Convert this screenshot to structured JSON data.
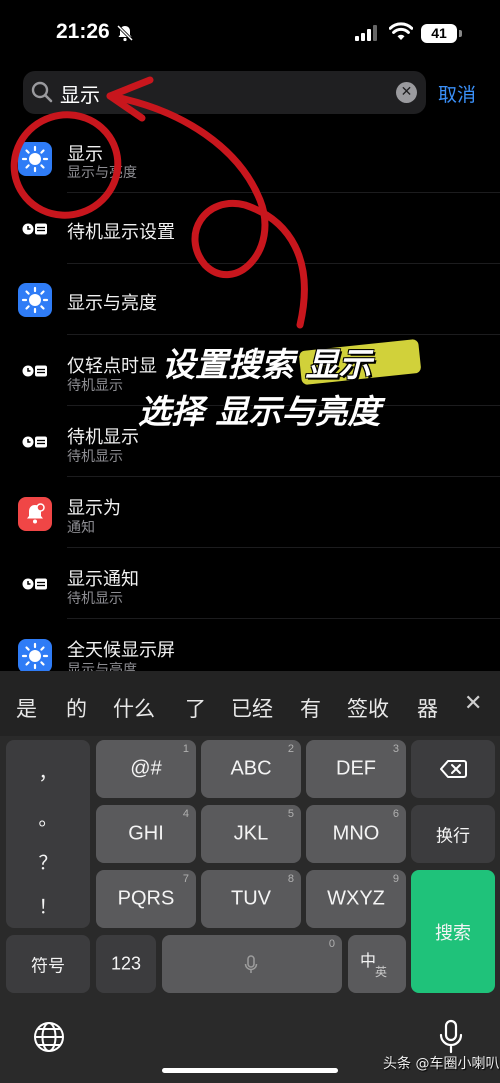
{
  "status": {
    "time": "21:26",
    "battery": "41"
  },
  "search": {
    "query": "显示",
    "cancel": "取消"
  },
  "results": [
    {
      "title": "显示",
      "sub": "显示与亮度"
    },
    {
      "title": "待机显示设置",
      "sub": ""
    },
    {
      "title": "显示与亮度",
      "sub": ""
    },
    {
      "title": "仅轻点时显",
      "sub": "待机显示"
    },
    {
      "title": "待机显示",
      "sub": "待机显示"
    },
    {
      "title": "显示为",
      "sub": "通知"
    },
    {
      "title": "显示通知",
      "sub": "待机显示"
    },
    {
      "title": "全天候显示屏",
      "sub": "显示与亮度"
    }
  ],
  "overlay": {
    "line1": "设置搜索 显示",
    "line2": "选择 显示与亮度"
  },
  "suggestions": [
    "是",
    "的",
    "什么",
    "了",
    "已经",
    "有",
    "签收",
    "器"
  ],
  "keyboard": {
    "punct": [
      "，",
      "。",
      "？",
      "！"
    ],
    "rows": [
      [
        {
          "label": "@#",
          "num": "1"
        },
        {
          "label": "ABC",
          "num": "2"
        },
        {
          "label": "DEF",
          "num": "3"
        }
      ],
      [
        {
          "label": "GHI",
          "num": "4"
        },
        {
          "label": "JKL",
          "num": "5"
        },
        {
          "label": "MNO",
          "num": "6"
        }
      ],
      [
        {
          "label": "PQRS",
          "num": "7"
        },
        {
          "label": "TUV",
          "num": "8"
        },
        {
          "label": "WXYZ",
          "num": "9"
        }
      ]
    ],
    "newline": "换行",
    "search": "搜索",
    "symbols": "符号",
    "num_mode": "123",
    "space_num": "0",
    "lang_top": "中",
    "lang_bottom": "英"
  },
  "watermark": "头条 @车圈小喇叭",
  "colors": {
    "accent": "#3a8ff7",
    "search_key": "#1fc27a",
    "annotation": "#c8161d"
  }
}
